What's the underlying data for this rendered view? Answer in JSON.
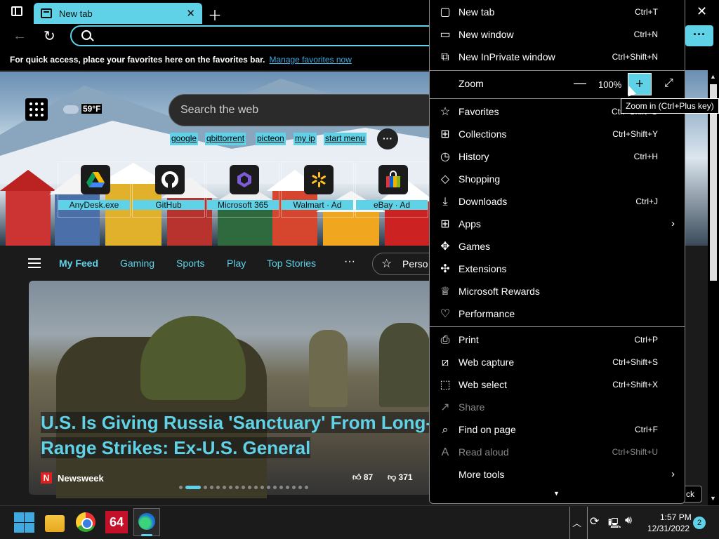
{
  "tab": {
    "title": "New tab"
  },
  "favbar": {
    "text": "For quick access, place your favorites here on the favorites bar.",
    "link": "Manage favorites now"
  },
  "weather": {
    "temp": "59°F"
  },
  "search": {
    "placeholder": "Search the web"
  },
  "quick_links": [
    "google",
    "qbittorrent",
    "picteon",
    "my ip",
    "start menu"
  ],
  "tiles": [
    "AnyDesk.exe",
    "GitHub",
    "Microsoft 365",
    "Walmart · Ad",
    "eBay · Ad"
  ],
  "feed_nav": {
    "items": [
      "My Feed",
      "Gaming",
      "Sports",
      "Play",
      "Top Stories"
    ],
    "more": "···",
    "personalize": "Perso"
  },
  "article": {
    "headline_line1": "U.S. Is Giving Russia 'Sanctuary' From Long-",
    "headline_line2": "Range Strikes: Ex-U.S. General",
    "source_badge": "N",
    "source": "Newsweek",
    "likes": "87",
    "dislikes": "371"
  },
  "menu": {
    "new_tab": {
      "label": "New tab",
      "shortcut": "Ctrl+T"
    },
    "new_window": {
      "label": "New window",
      "shortcut": "Ctrl+N"
    },
    "new_inprivate": {
      "label": "New InPrivate window",
      "shortcut": "Ctrl+Shift+N"
    },
    "zoom": {
      "label": "Zoom",
      "value": "100%",
      "minus": "—",
      "plus": "+"
    },
    "favorites": {
      "label": "Favorites",
      "shortcut": "Ctrl+Shift+O"
    },
    "collections": {
      "label": "Collections",
      "shortcut": "Ctrl+Shift+Y"
    },
    "history": {
      "label": "History",
      "shortcut": "Ctrl+H"
    },
    "shopping": {
      "label": "Shopping"
    },
    "downloads": {
      "label": "Downloads",
      "shortcut": "Ctrl+J"
    },
    "apps": {
      "label": "Apps"
    },
    "games": {
      "label": "Games"
    },
    "extensions": {
      "label": "Extensions"
    },
    "rewards": {
      "label": "Microsoft Rewards"
    },
    "performance": {
      "label": "Performance"
    },
    "print": {
      "label": "Print",
      "shortcut": "Ctrl+P"
    },
    "web_capture": {
      "label": "Web capture",
      "shortcut": "Ctrl+Shift+S"
    },
    "web_select": {
      "label": "Web select",
      "shortcut": "Ctrl+Shift+X"
    },
    "share": {
      "label": "Share"
    },
    "find": {
      "label": "Find on page",
      "shortcut": "Ctrl+F"
    },
    "read_aloud": {
      "label": "Read aloud",
      "shortcut": "Ctrl+Shift+U"
    },
    "more_tools": {
      "label": "More tools"
    }
  },
  "tooltip": "Zoom in (Ctrl+Plus key)",
  "feedback": "ck",
  "taskbar": {
    "hwinfo": "64",
    "time": "1:57 PM",
    "date": "12/31/2022",
    "notifications": "2"
  },
  "colors": {
    "accent": "#5fd2e8",
    "menu_bg": "#000000",
    "page_bg": "#1b1b1b",
    "link": "#3fa9e0"
  }
}
